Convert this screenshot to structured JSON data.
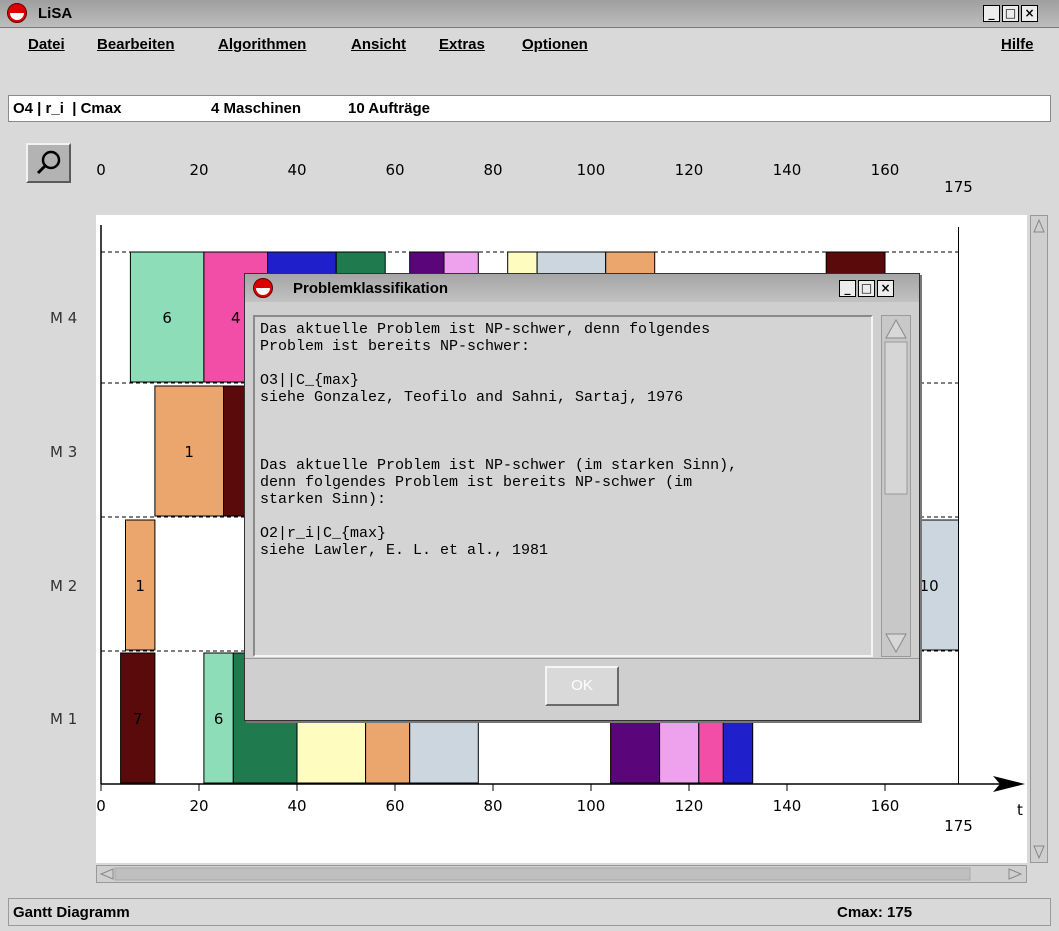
{
  "window": {
    "title": "LiSA",
    "minimize_glyph": "_",
    "maximize_glyph": "□",
    "close_glyph": "×"
  },
  "menu": {
    "items": [
      "Datei",
      "Bearbeiten",
      "Algorithmen",
      "Ansicht",
      "Extras",
      "Optionen"
    ],
    "help": "Hilfe"
  },
  "problem": {
    "notation": "O4 | r_i  | Cmax",
    "machines": "4 Maschinen",
    "jobs": "10 Aufträge"
  },
  "toolbar": {
    "zoom_icon": "magnifier-icon"
  },
  "chart_data": {
    "type": "gantt",
    "x_ticks": [
      "0",
      "20",
      "40",
      "60",
      "80",
      "100",
      "120",
      "140",
      "160"
    ],
    "x_end_label": "175",
    "x_axis_label": "t",
    "xlim": [
      0,
      175
    ],
    "machines": [
      "M 4",
      "M 3",
      "M 2",
      "M 1"
    ],
    "colors": {
      "1": "#eaa66c",
      "2": "#1f1fcc",
      "3": "#1f7a4e",
      "4": "#f24ea8",
      "5": "#fffcc0",
      "6": "#8ddeb8",
      "7": "#5a0a0a",
      "8": "#5b057a",
      "9": "#eea2ee",
      "10": "#ccd6de"
    },
    "operations": [
      {
        "machine": "M 4",
        "job": "6",
        "start": 6,
        "end": 21,
        "label": "6"
      },
      {
        "machine": "M 4",
        "job": "4",
        "start": 21,
        "end": 34,
        "label": "4"
      },
      {
        "machine": "M 4",
        "job": "2",
        "start": 34,
        "end": 48
      },
      {
        "machine": "M 4",
        "job": "3",
        "start": 48,
        "end": 58
      },
      {
        "machine": "M 4",
        "job": "8",
        "start": 63,
        "end": 70
      },
      {
        "machine": "M 4",
        "job": "9",
        "start": 70,
        "end": 77
      },
      {
        "machine": "M 4",
        "job": "5",
        "start": 83,
        "end": 89
      },
      {
        "machine": "M 4",
        "job": "10",
        "start": 89,
        "end": 103
      },
      {
        "machine": "M 4",
        "job": "1",
        "start": 103,
        "end": 113
      },
      {
        "machine": "M 4",
        "job": "7",
        "start": 148,
        "end": 160
      },
      {
        "machine": "M 3",
        "job": "1",
        "start": 11,
        "end": 25,
        "label": "1"
      },
      {
        "machine": "M 3",
        "job": "7",
        "start": 25,
        "end": 32
      },
      {
        "machine": "M 2",
        "job": "1",
        "start": 5,
        "end": 11,
        "label": "1"
      },
      {
        "machine": "M 2",
        "job": "10",
        "start": 163,
        "end": 175,
        "label": "10"
      },
      {
        "machine": "M 1",
        "job": "7",
        "start": 4,
        "end": 11,
        "label": "7"
      },
      {
        "machine": "M 1",
        "job": "6",
        "start": 21,
        "end": 27,
        "label": "6"
      },
      {
        "machine": "M 1",
        "job": "3",
        "start": 27,
        "end": 40
      },
      {
        "machine": "M 1",
        "job": "5",
        "start": 40,
        "end": 54
      },
      {
        "machine": "M 1",
        "job": "1",
        "start": 54,
        "end": 63
      },
      {
        "machine": "M 1",
        "job": "10",
        "start": 63,
        "end": 77
      },
      {
        "machine": "M 1",
        "job": "8",
        "start": 104,
        "end": 114
      },
      {
        "machine": "M 1",
        "job": "9",
        "start": 114,
        "end": 122
      },
      {
        "machine": "M 1",
        "job": "4",
        "start": 122,
        "end": 127
      },
      {
        "machine": "M 1",
        "job": "2",
        "start": 127,
        "end": 133
      }
    ]
  },
  "dialog": {
    "title": "Problemklassifikation",
    "text": "Das aktuelle Problem ist NP-schwer, denn folgendes\nProblem ist bereits NP-schwer:\n\nO3||C_{max}\nsiehe Gonzalez, Teofilo and Sahni, Sartaj, 1976\n\n\n\nDas aktuelle Problem ist NP-schwer (im starken Sinn),\ndenn folgendes Problem ist bereits NP-schwer (im\nstarken Sinn):\n\nO2|r_i|C_{max}\nsiehe Lawler, E. L. et al., 1981",
    "ok_label": "OK"
  },
  "status": {
    "view": "Gantt Diagramm",
    "cmax": "Cmax: 175"
  }
}
